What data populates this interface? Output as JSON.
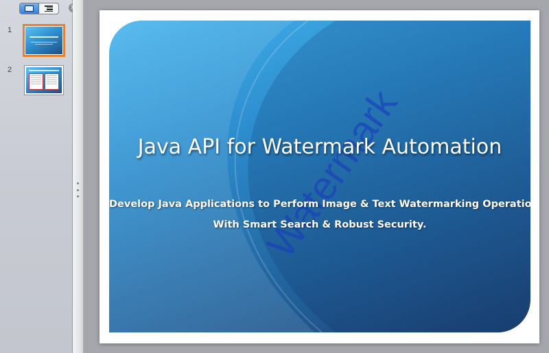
{
  "sidebar": {
    "view_toggle": {
      "slide_icon": "slide-view-icon",
      "outline_icon": "outline-view-icon",
      "active": "slide"
    },
    "close_icon": "close-icon",
    "close_glyph": "✕",
    "thumbnails": [
      {
        "number": "1",
        "selected": true
      },
      {
        "number": "2",
        "selected": false
      }
    ]
  },
  "slide": {
    "title": "Java API for Watermark Automation",
    "subtitle_line1": "Develop Java Applications to Perform Image & Text Watermarking Operations",
    "subtitle_line2": "With Smart Search & Robust Security.",
    "watermark": "Watermark"
  },
  "colors": {
    "selection_outline": "#e9802f",
    "toggle_active": "#2f81e6",
    "slide_bg_top": "#45b4ee",
    "slide_bg_bottom": "#1c4274",
    "watermark": "#193cbe"
  }
}
